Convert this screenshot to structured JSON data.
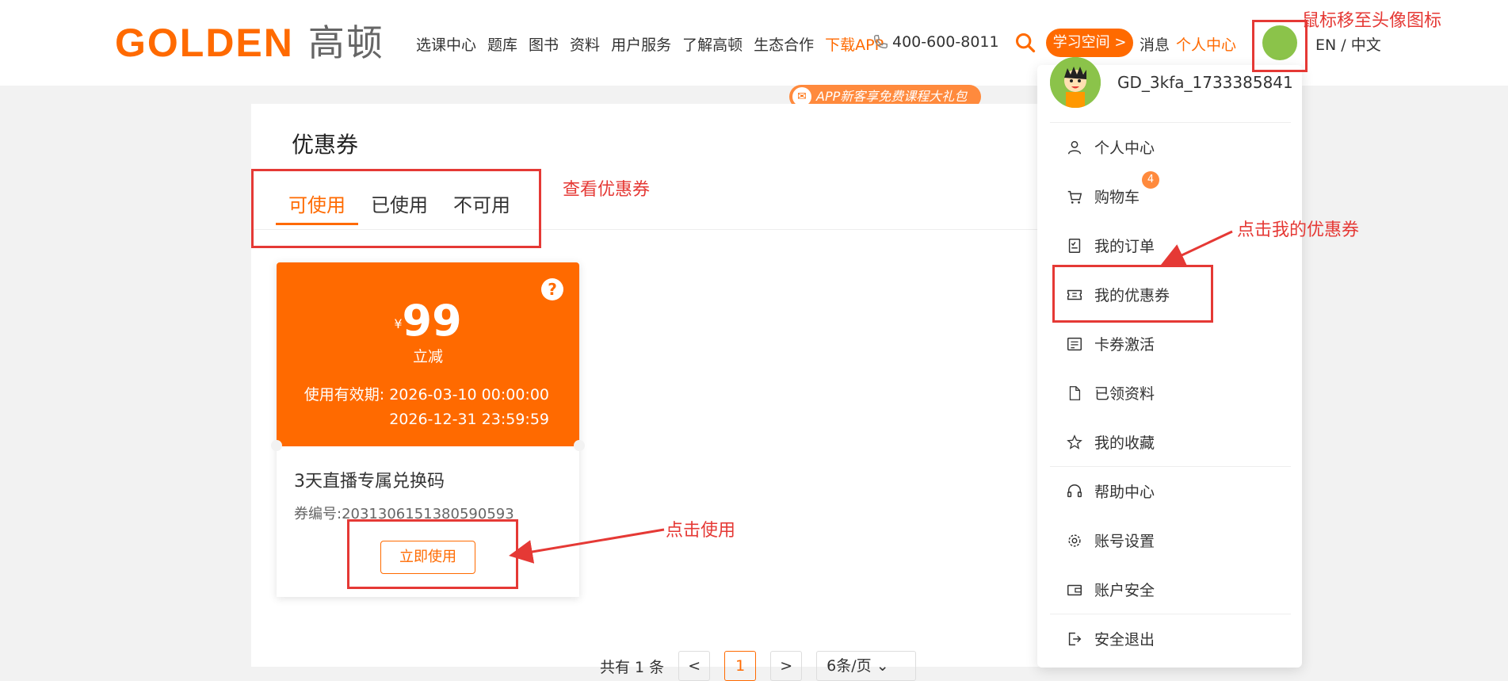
{
  "header": {
    "logo_en": "GOLDEN",
    "logo_cn": "高顿",
    "nav": [
      "选课中心",
      "题库",
      "图书",
      "资料",
      "用户服务",
      "了解高顿",
      "生态合作",
      "下载APP"
    ],
    "phone": "400-600-8011",
    "study_button": "学习空间 >",
    "message": "消息",
    "personal": "个人中心",
    "lang_en": "EN",
    "lang_sep": "/",
    "lang_cn": "中文",
    "promo": "APP新客享免费课程大礼包",
    "accent_color": "#ff6a00"
  },
  "main": {
    "title": "优惠券",
    "tabs": [
      "可使用",
      "已使用",
      "不可用"
    ],
    "coupon": {
      "currency": "¥",
      "amount": "99",
      "type": "立减",
      "valid_label": "使用有效期:",
      "valid_from": "2026-03-10 00:00:00",
      "valid_to": "2026-12-31 23:59:59",
      "name": "3天直播专属兑换码",
      "no_label": "券编号:",
      "no": "2031306151380590593",
      "use_button": "立即使用"
    },
    "pager": {
      "total": "共有 1 条",
      "prev": "<",
      "page": "1",
      "next": ">",
      "size": "6条/页 ⌄"
    }
  },
  "dropdown": {
    "username": "GD_3kfa_1733385841",
    "items": [
      {
        "label": "个人中心",
        "icon": "user-icon"
      },
      {
        "label": "购物车",
        "icon": "cart-icon",
        "badge": "4"
      },
      {
        "label": "我的订单",
        "icon": "order-icon"
      },
      {
        "label": "我的优惠券",
        "icon": "coupon-icon"
      },
      {
        "label": "卡券激活",
        "icon": "card-icon"
      },
      {
        "label": "已领资料",
        "icon": "file-icon"
      },
      {
        "label": "我的收藏",
        "icon": "star-icon"
      },
      {
        "label": "帮助中心",
        "icon": "headset-icon"
      },
      {
        "label": "账号设置",
        "icon": "gear-icon"
      },
      {
        "label": "账户安全",
        "icon": "wallet-icon"
      },
      {
        "label": "安全退出",
        "icon": "logout-icon"
      }
    ]
  },
  "annotations": {
    "hover_avatar": "鼠标移至头像图标",
    "view_coupon": "查看优惠券",
    "click_my_coupon": "点击我的优惠券",
    "click_use": "点击使用",
    "color": "#e53935"
  }
}
